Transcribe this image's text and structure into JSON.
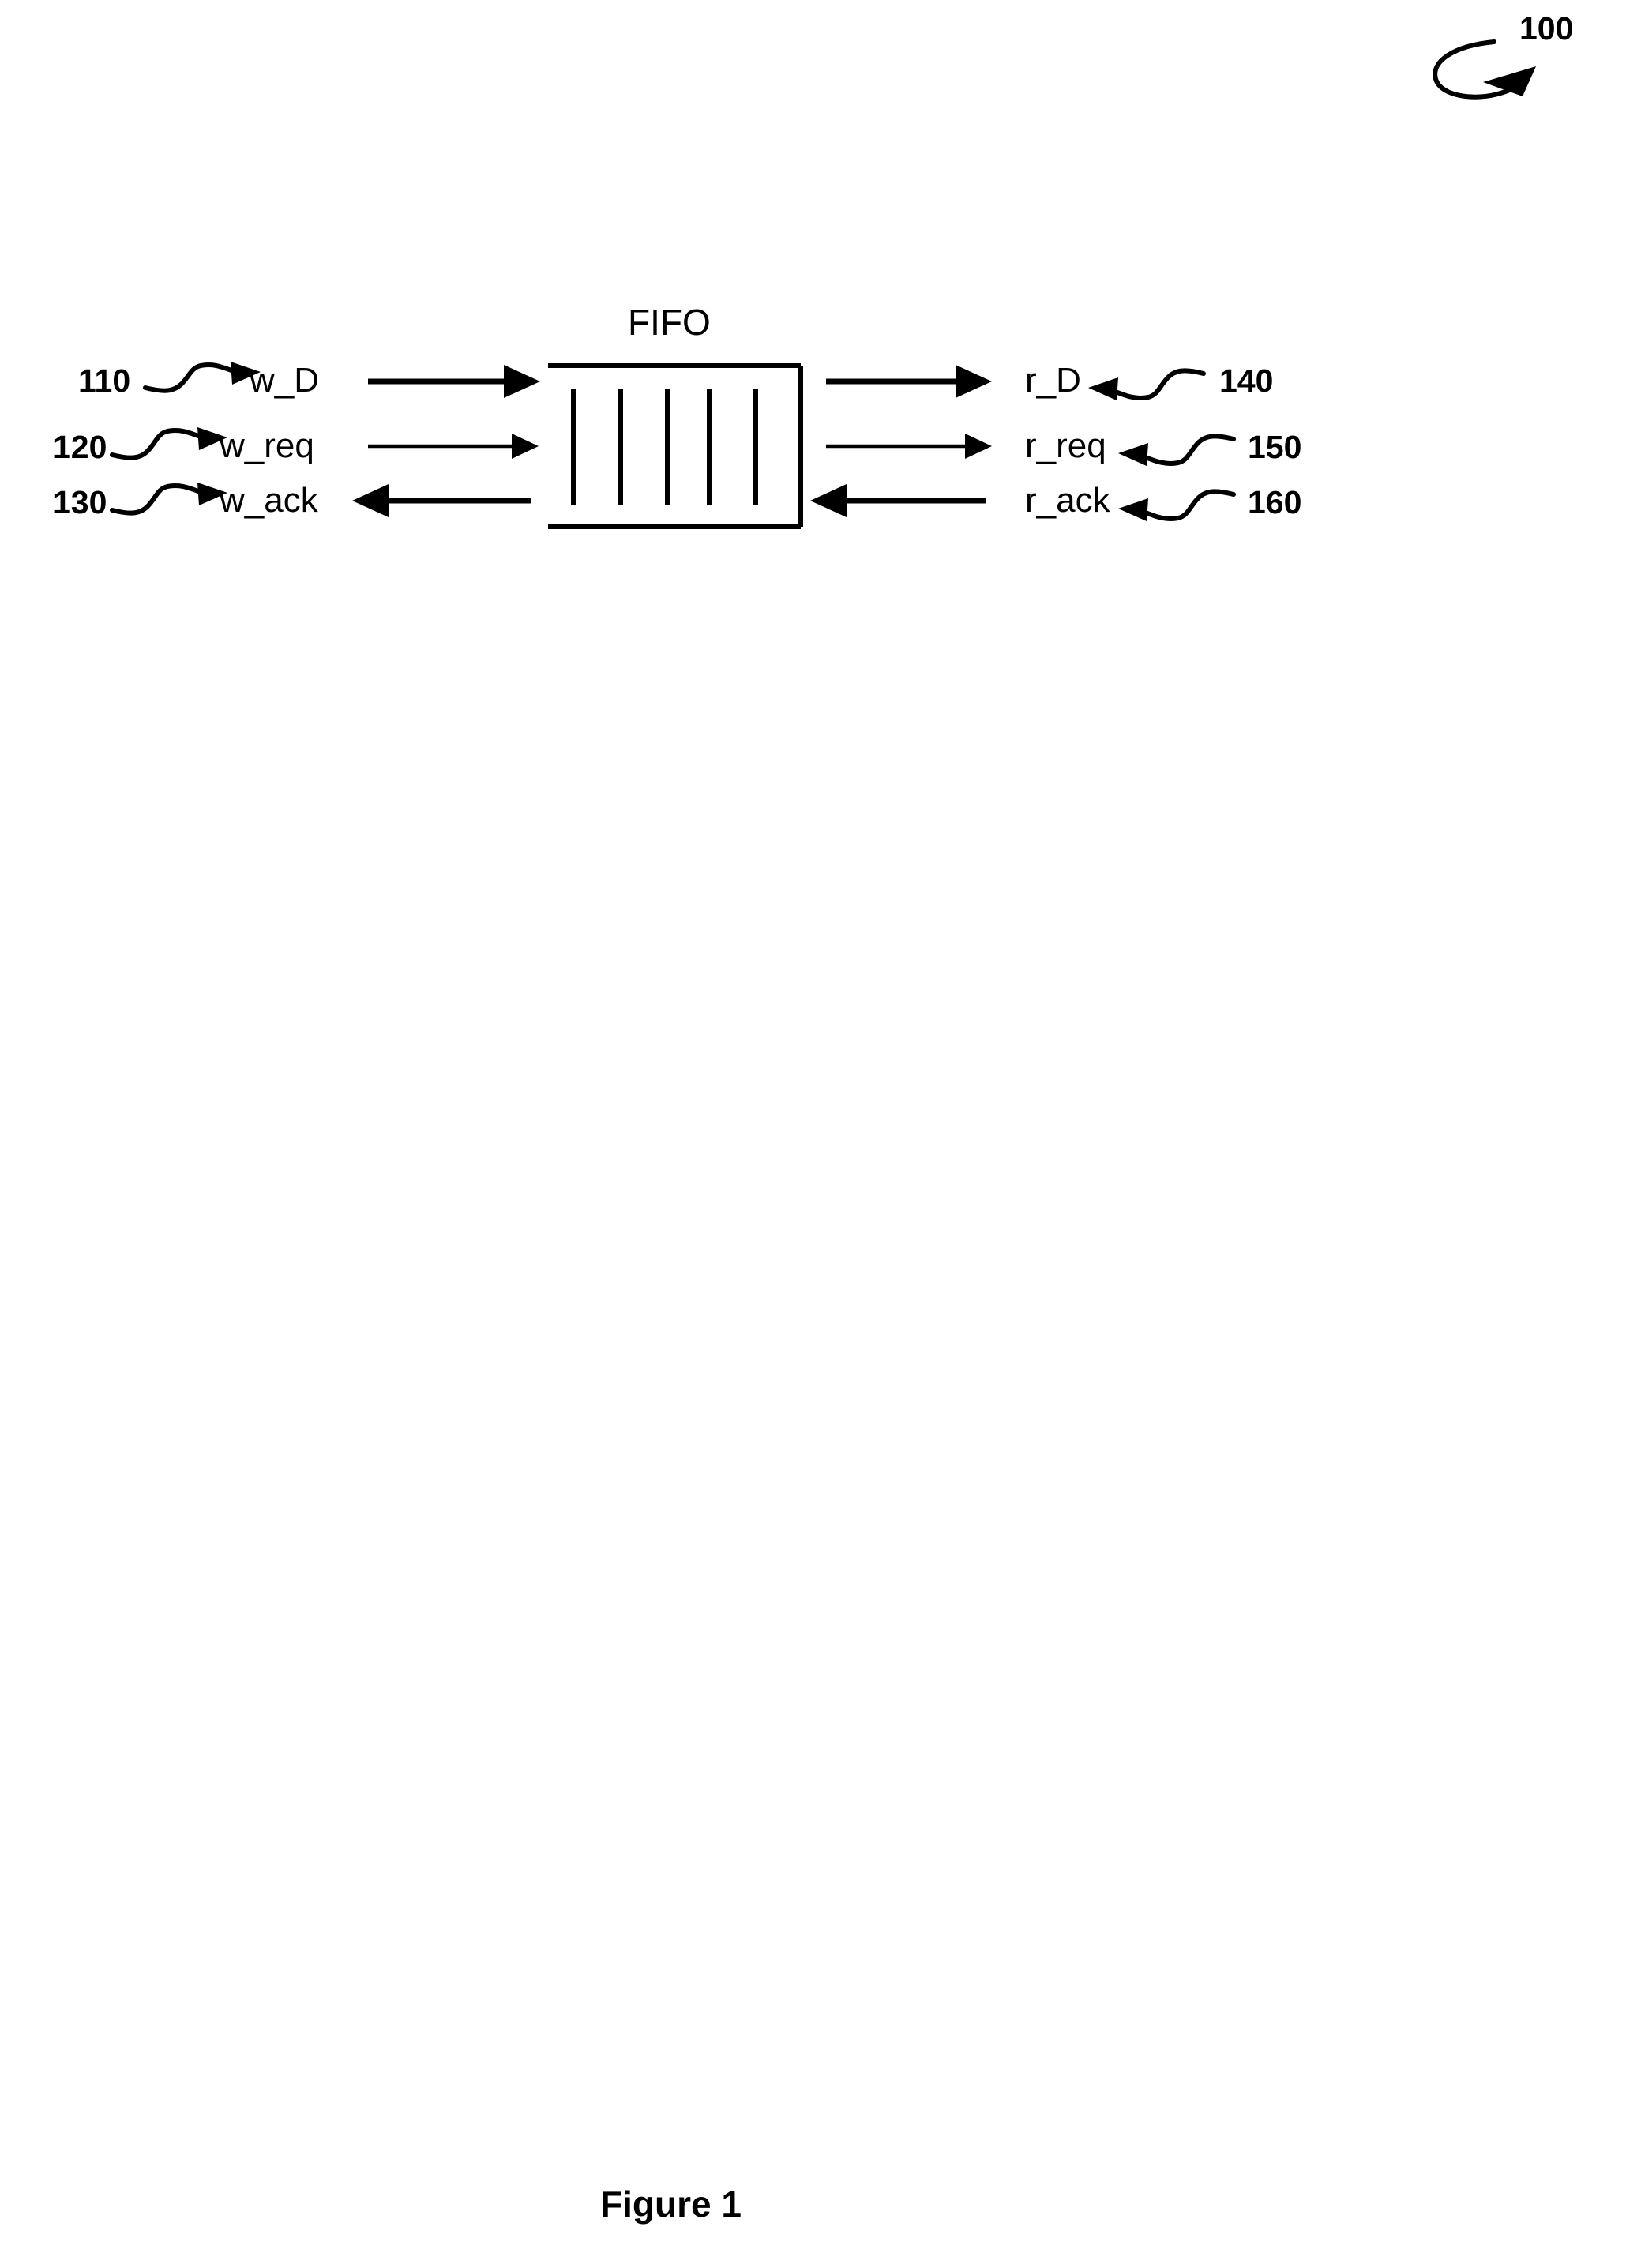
{
  "figure": {
    "caption": "Figure 1",
    "assembly_ref": "100"
  },
  "block": {
    "label": "FIFO",
    "cell_count": 5
  },
  "write_side": {
    "signals": [
      {
        "ref": "110",
        "name": "w_D",
        "direction": "into-fifo",
        "line_weight": "heavy"
      },
      {
        "ref": "120",
        "name": "w_req",
        "direction": "into-fifo",
        "line_weight": "light"
      },
      {
        "ref": "130",
        "name": "w_ack",
        "direction": "from-fifo",
        "line_weight": "heavy"
      }
    ]
  },
  "read_side": {
    "signals": [
      {
        "ref": "140",
        "name": "r_D",
        "direction": "from-fifo",
        "line_weight": "heavy"
      },
      {
        "ref": "150",
        "name": "r_req",
        "direction": "from-fifo",
        "line_weight": "light"
      },
      {
        "ref": "160",
        "name": "r_ack",
        "direction": "into-fifo",
        "line_weight": "heavy"
      }
    ]
  },
  "colors": {
    "ink": "#000000",
    "paper": "#ffffff"
  }
}
